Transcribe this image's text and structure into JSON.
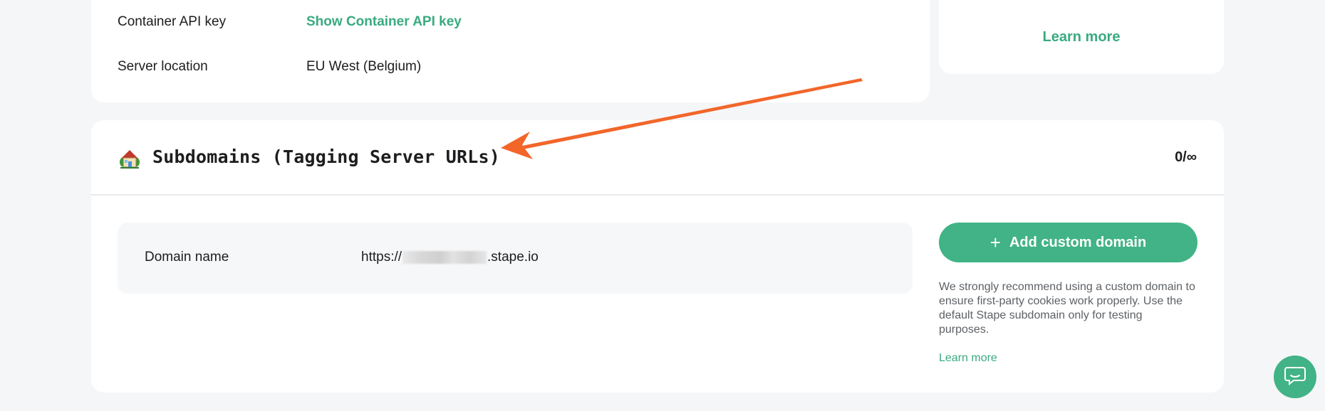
{
  "settings": {
    "api_key_label": "Container API key",
    "api_key_link": "Show Container API key",
    "location_label": "Server location",
    "location_value": "EU West (Belgium)"
  },
  "side_card": {
    "learn_more": "Learn more"
  },
  "subdomains": {
    "title": "Subdomains (Tagging Server URLs)",
    "count": "0/∞",
    "domain_label": "Domain name",
    "domain_prefix": "https://",
    "domain_suffix": ".stape.io",
    "add_button": "Add custom domain",
    "recommend_text": "We strongly recommend using a custom domain to ensure first-party cookies work properly. Use the default Stape subdomain only for testing purposes.",
    "learn_more": "Learn more"
  },
  "icons": {
    "house": "house-with-garden-icon",
    "plus": "plus-icon",
    "chat": "chat-icon"
  },
  "colors": {
    "accent": "#41b386",
    "link": "#3aaa80",
    "annotation_arrow": "#f2662a"
  }
}
